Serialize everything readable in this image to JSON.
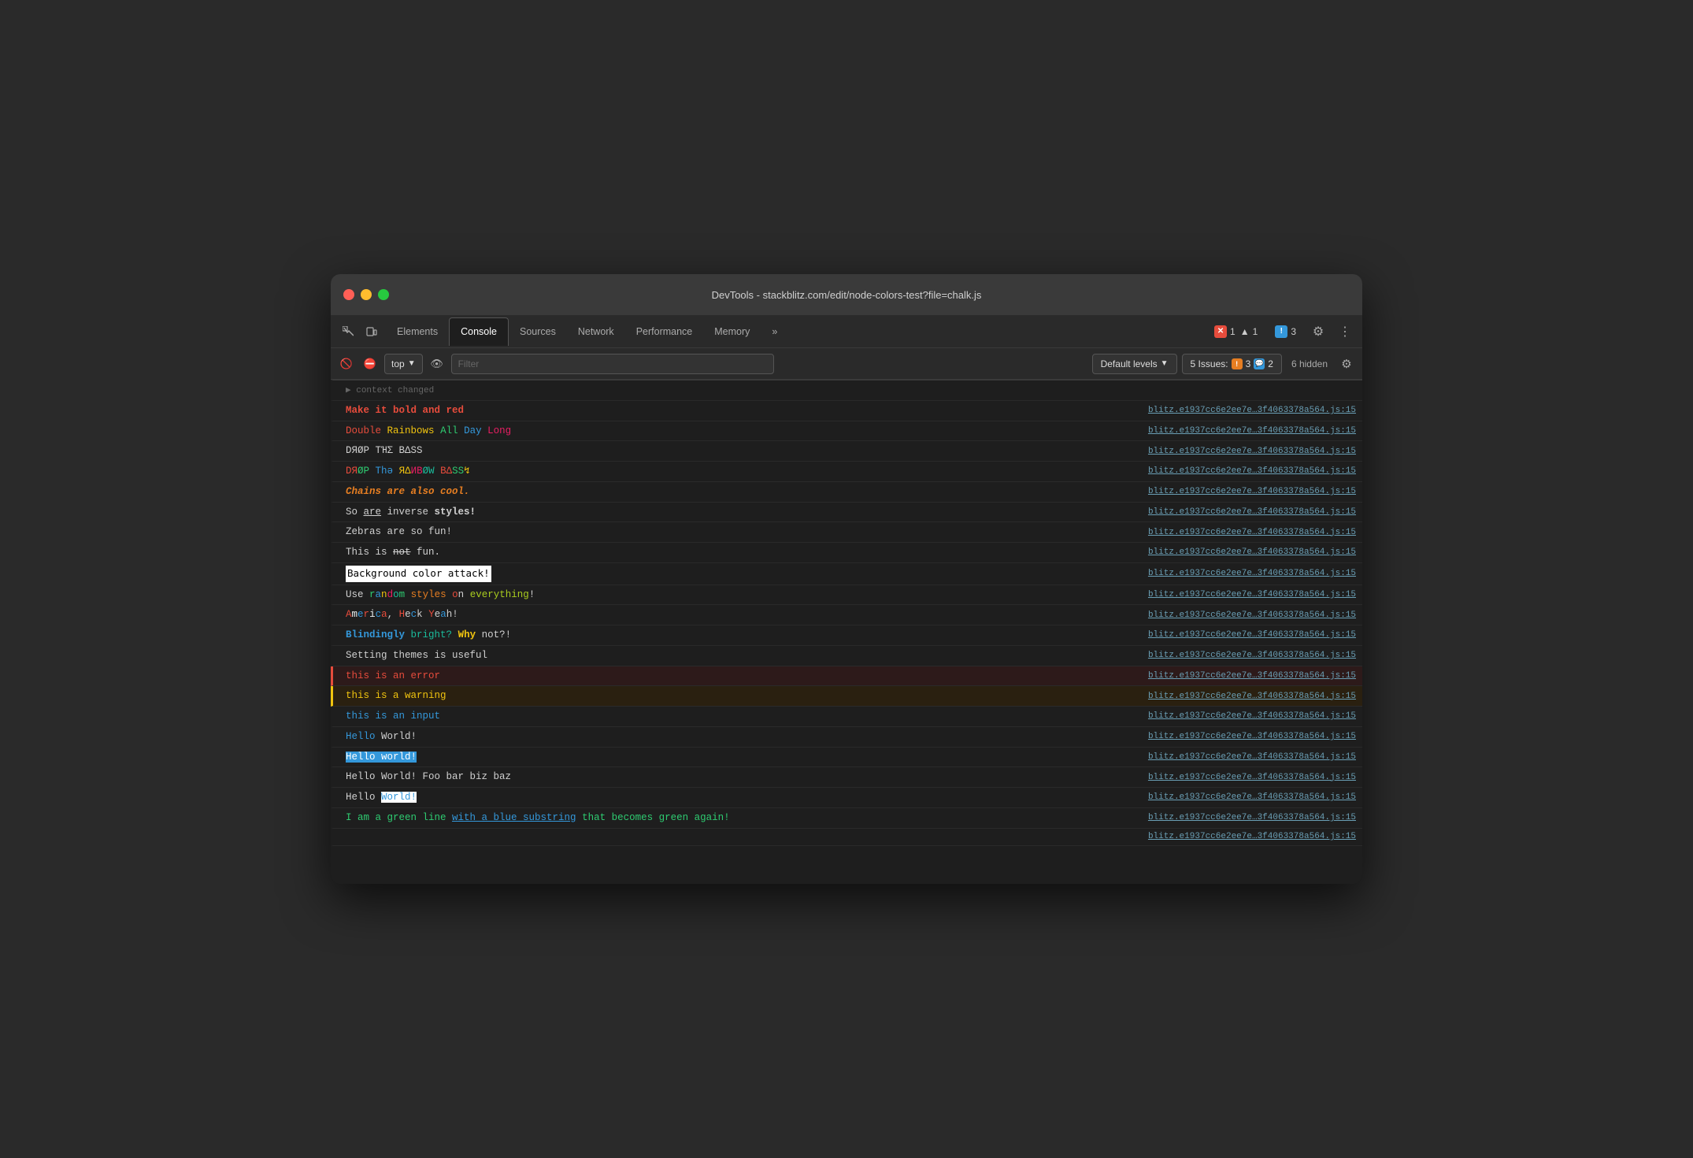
{
  "window": {
    "title": "DevTools - stackblitz.com/edit/node-colors-test?file=chalk.js"
  },
  "tabs": {
    "items": [
      {
        "label": "Elements",
        "active": false
      },
      {
        "label": "Console",
        "active": true
      },
      {
        "label": "Sources",
        "active": false
      },
      {
        "label": "Network",
        "active": false
      },
      {
        "label": "Performance",
        "active": false
      },
      {
        "label": "Memory",
        "active": false
      }
    ],
    "more_label": "»",
    "badges": {
      "red": {
        "icon": "✕",
        "count": "1"
      },
      "warning": {
        "icon": "▲",
        "count": "1"
      },
      "info": {
        "icon": "!",
        "count": "3"
      }
    },
    "gear_icon": "⚙",
    "more_icon": "⋮"
  },
  "toolbar": {
    "top_label": "top",
    "filter_placeholder": "Filter",
    "default_levels": "Default levels",
    "issues_label": "5 Issues:",
    "issues_warn_count": "3",
    "issues_info_count": "2",
    "hidden_label": "6 hidden"
  },
  "console_rows": [
    {
      "id": "r0",
      "type": "separator",
      "msg_html": "<span class='c-default' style='font-size:11px;color:#666'>▶ context changed</span>",
      "src": ""
    },
    {
      "id": "r1",
      "type": "normal",
      "msg_html": "<span class='c-red bold'>Make it bold and red</span>",
      "src": "blitz.e1937cc6e2ee7e…3f4063378a564.js:15"
    },
    {
      "id": "r2",
      "type": "normal",
      "msg_html": "<span class='c-red'>Double</span> <span class='c-yellow'>Rainbows</span> <span class='c-green'>All</span> <span class='c-blue'>Day</span> <span class='c-magenta'>Long</span>",
      "src": "blitz.e1937cc6e2ee7e…3f4063378a564.js:15"
    },
    {
      "id": "r3",
      "type": "normal",
      "msg_html": "<span class='c-default'>DЯØP TΉΣ BΔSS</span>",
      "src": "blitz.e1937cc6e2ee7e…3f4063378a564.js:15"
    },
    {
      "id": "r4",
      "type": "normal",
      "msg_html": "<span class='c-red'>DЯ</span><span class='c-green'>ØP</span> <span class='c-blue'>Thə</span> <span class='c-yellow'>ЯΔ</span><span class='c-magenta'>ИB</span><span class='c-cyan'>ØW</span> <span class='c-red'>BΔ</span><span class='c-green'>SS</span><span class='c-yellow'>↯</span>",
      "src": "blitz.e1937cc6e2ee7e…3f4063378a564.js:15"
    },
    {
      "id": "r5",
      "type": "normal",
      "msg_html": "<span class='chains'>Chains are also cool.</span>",
      "src": "blitz.e1937cc6e2ee7e…3f4063378a564.js:15"
    },
    {
      "id": "r6",
      "type": "normal",
      "msg_html": "<span class='c-default'>So </span><span class='c-default underline'>are</span><span class='c-default'> inverse </span><span class='c-default bold'>styles!</span>",
      "src": "blitz.e1937cc6e2ee7e…3f4063378a564.js:15"
    },
    {
      "id": "r7",
      "type": "normal",
      "msg_html": "<span class='c-default'>Zebras are so fun!</span>",
      "src": "blitz.e1937cc6e2ee7e…3f4063378a564.js:15"
    },
    {
      "id": "r8",
      "type": "normal",
      "msg_html": "<span class='c-default'>This is <span class='strikethrough'>not</span> fun.</span>",
      "src": "blitz.e1937cc6e2ee7e…3f4063378a564.js:15"
    },
    {
      "id": "r9",
      "type": "normal",
      "msg_html": "<span class='bg-attack'>Background color attack!</span>",
      "src": "blitz.e1937cc6e2ee7e…3f4063378a564.js:15"
    },
    {
      "id": "r10",
      "type": "normal",
      "msg_html": "<span class='c-default'>Use </span><span class='c-green'>r</span><span class='c-blue'>a</span><span class='c-yellow'>n</span><span class='c-magenta'>d</span><span class='c-cyan'>o</span><span class='c-green'>m</span><span class='c-default'> </span><span class='c-orange'>styles</span><span class='c-default'> </span><span class='c-red'>o</span><span class='c-default'>n</span><span class='c-default'> </span><span class='c-lime'>everything</span><span class='c-default'>!</span>",
      "src": "blitz.e1937cc6e2ee7e…3f4063378a564.js:15"
    },
    {
      "id": "r11",
      "type": "normal",
      "msg_html": "<span class='c-red'>A</span><span class='c-white'>m</span><span class='c-blue'>e</span><span class='c-red'>r</span><span class='c-white'>i</span><span class='c-blue'>c</span><span class='c-red'>a</span><span class='c-default'>, </span><span class='c-red'>H</span><span class='c-default'>e</span><span class='c-blue'>c</span><span class='c-default'>k</span><span class='c-default'> </span><span class='c-red'>Y</span><span class='c-default'>e</span><span class='c-blue'>a</span><span class='c-default'>h!</span>",
      "src": "blitz.e1937cc6e2ee7e…3f4063378a564.js:15"
    },
    {
      "id": "r12",
      "type": "normal",
      "msg_html": "<span class='c-blue bold'>Blindingly</span><span class='c-default'> </span><span class='c-cyan'>bright?</span><span class='c-default'> </span><span class='c-yellow bold'>Why</span><span class='c-default'> not?!</span>",
      "src": "blitz.e1937cc6e2ee7e…3f4063378a564.js:15"
    },
    {
      "id": "r13",
      "type": "normal",
      "msg_html": "<span class='c-default'>Setting themes is useful</span>",
      "src": "blitz.e1937cc6e2ee7e…3f4063378a564.js:15"
    },
    {
      "id": "r14",
      "type": "error",
      "msg_html": "<span class='c-error'>this is an error</span>",
      "src": "blitz.e1937cc6e2ee7e…3f4063378a564.js:15"
    },
    {
      "id": "r15",
      "type": "warning",
      "msg_html": "<span class='c-warning'>this is a warning</span>",
      "src": "blitz.e1937cc6e2ee7e…3f4063378a564.js:15"
    },
    {
      "id": "r16",
      "type": "normal",
      "msg_html": "<span class='c-input'>this is an input</span>",
      "src": "blitz.e1937cc6e2ee7e…3f4063378a564.js:15"
    },
    {
      "id": "r17",
      "type": "normal",
      "msg_html": "<span class='c-blue'>Hello</span><span class='c-default'> </span><span class='c-default'>World!</span>",
      "src": "blitz.e1937cc6e2ee7e…3f4063378a564.js:15"
    },
    {
      "id": "r18",
      "type": "normal",
      "msg_html": "<span class='hl-blue-bg'>Hello world!</span>",
      "src": "blitz.e1937cc6e2ee7e…3f4063378a564.js:15"
    },
    {
      "id": "r19",
      "type": "normal",
      "msg_html": "<span class='c-default'>Hello World! Foo bar biz baz</span>",
      "src": "blitz.e1937cc6e2ee7e…3f4063378a564.js:15"
    },
    {
      "id": "r20",
      "type": "normal",
      "msg_html": "<span class='c-default'>Hello </span><span class='hl-white-bg'>World!</span>",
      "src": "blitz.e1937cc6e2ee7e…3f4063378a564.js:15"
    },
    {
      "id": "r21",
      "type": "normal",
      "msg_html": "<span class='c-green-line'>I am a green line </span><span class='c-blue underline'>with a blue substring</span><span class='c-green-line'> that becomes green again!</span>",
      "src": "blitz.e1937cc6e2ee7e…3f4063378a564.js:15"
    },
    {
      "id": "r22",
      "type": "normal",
      "msg_html": "",
      "src": "blitz.e1937cc6e2ee7e…3f4063378a564.js:15"
    }
  ]
}
